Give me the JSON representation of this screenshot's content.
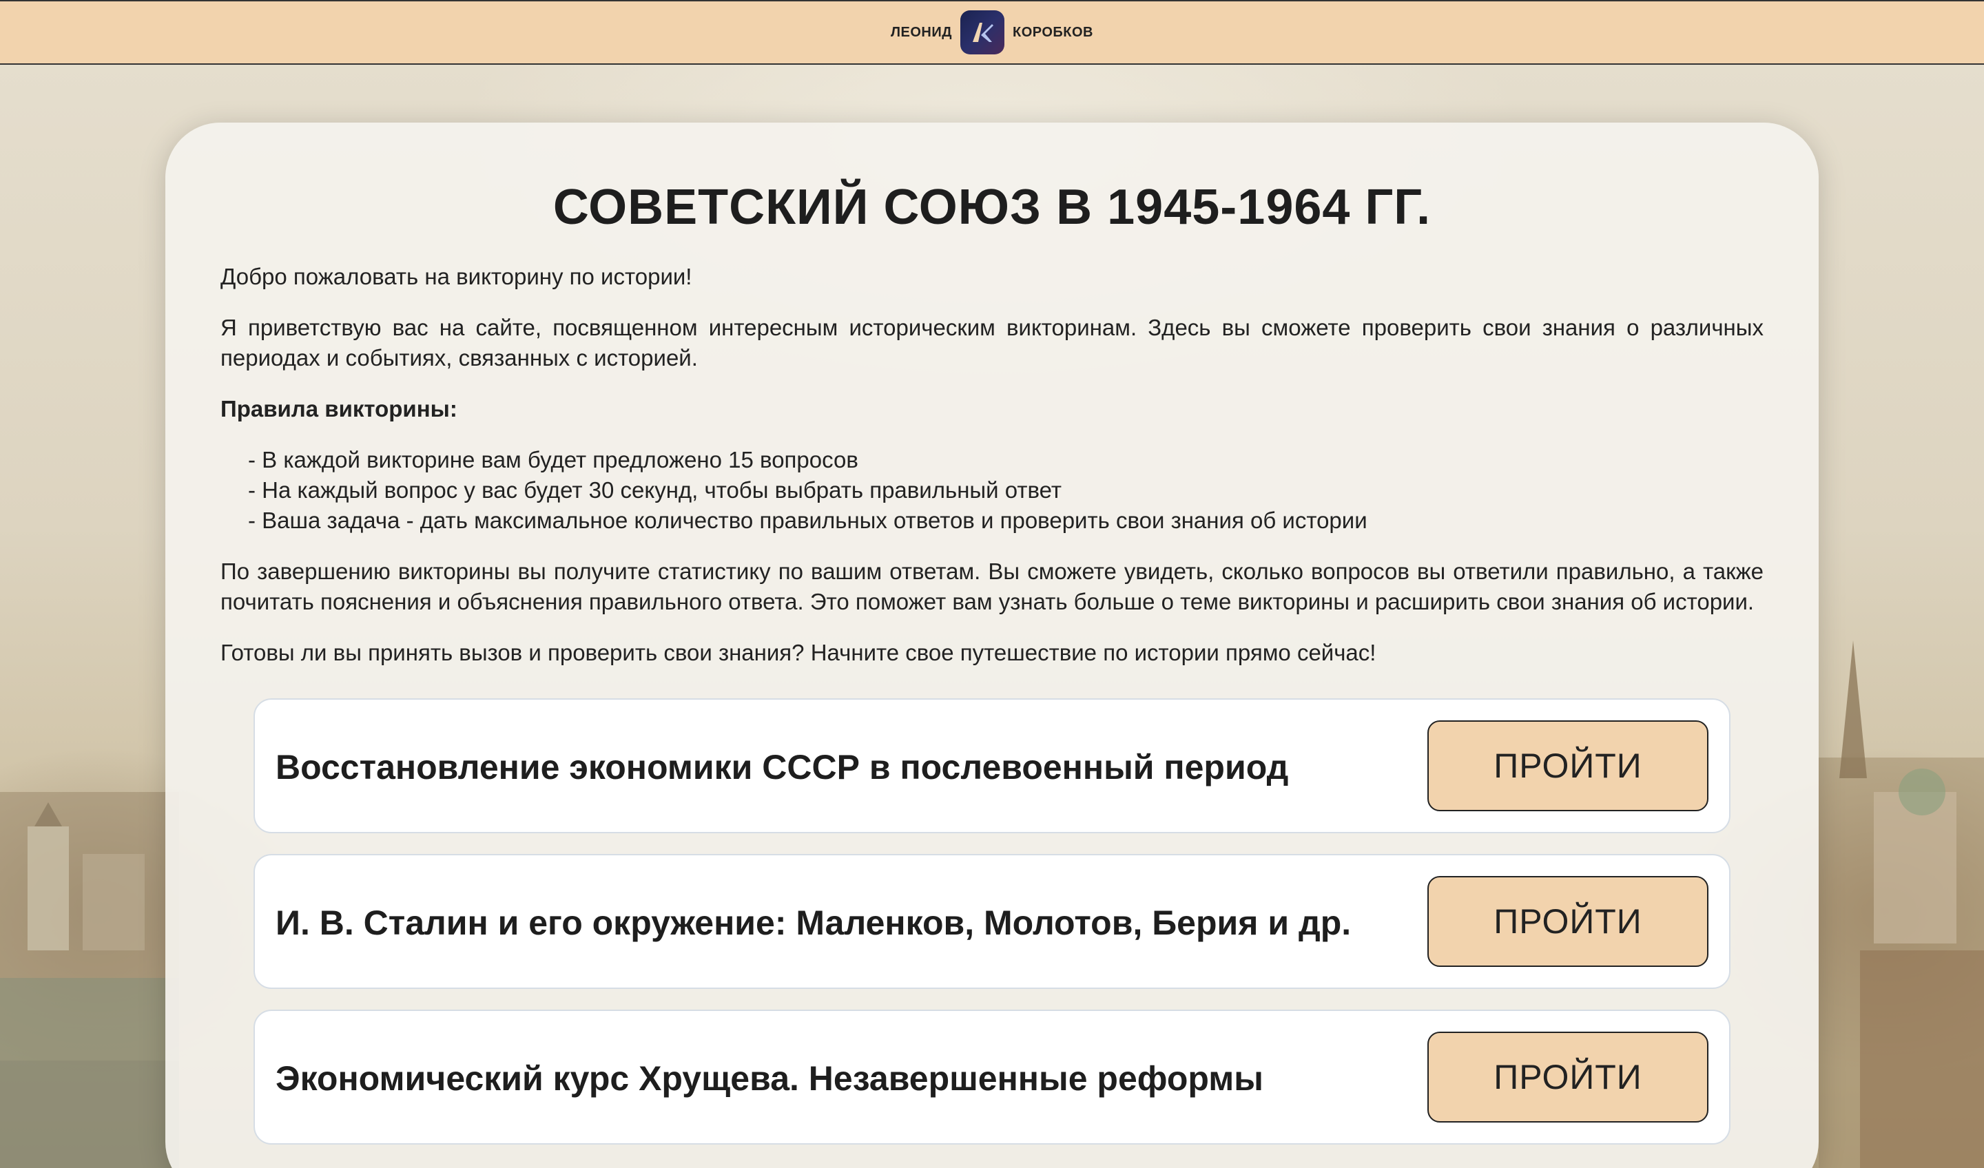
{
  "header": {
    "first_name": "ЛЕОНИД",
    "last_name": "КОРОБКОВ",
    "logo_letter": "ЛК",
    "bg_color": "#f2d3ad"
  },
  "main": {
    "title": "СОВЕТСКИЙ СОЮЗ В 1945-1964 ГГ.",
    "welcome": "Добро пожаловать на викторину по истории!",
    "intro": "Я приветствую вас на сайте, посвященном интересным историческим викторинам. Здесь вы сможете проверить свои знания о различных периодах и событиях, связанных с историей.",
    "rules_title": "Правила викторины:",
    "rules": [
      "- В каждой викторине вам будет предложено 15 вопросов",
      "- На каждый вопрос у вас будет 30 секунд, чтобы выбрать правильный ответ",
      "- Ваша задача - дать максимальное количество правильных ответов и проверить свои знания об истории"
    ],
    "after": "По завершению викторины вы получите статистику по вашим ответам. Вы сможете увидеть, сколько вопросов вы ответили правильно, а также почитать пояснения и объяснения правильного ответа. Это поможет вам узнать больше о теме викторины и расширить свои знания об истории.",
    "cta": "Готовы ли вы принять вызов и проверить свои знания? Начните свое путешествие по истории прямо сейчас!"
  },
  "quizzes": [
    {
      "title": "Восстановление экономики СССР в послевоенный период",
      "button": "ПРОЙТИ"
    },
    {
      "title": "И. В. Сталин и его окружение: Маленков, Молотов, Берия и др.",
      "button": "ПРОЙТИ"
    },
    {
      "title": "Экономический курс Хрущева. Незавершенные реформы",
      "button": "ПРОЙТИ"
    }
  ],
  "colors": {
    "accent": "#f2d3ad",
    "text": "#1e1e1e",
    "card": "#f4f2ed"
  }
}
